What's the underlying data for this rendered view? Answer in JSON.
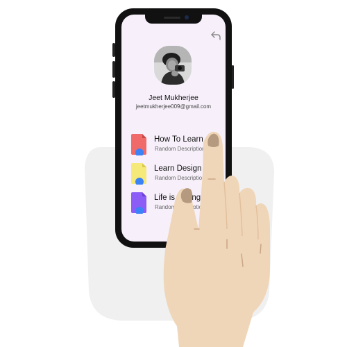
{
  "profile": {
    "name": "Jeet Mukherjee",
    "email": "jeetmukherjee009@gmail.com"
  },
  "items": [
    {
      "title": "How To Learn",
      "description": "Random Description",
      "icon": "document-icon",
      "color": "#f06a6a"
    },
    {
      "title": "Learn Design",
      "description": "Random Description",
      "icon": "document-icon",
      "color": "#f5e97a"
    },
    {
      "title": "Life is Strange",
      "description": "Random Description",
      "icon": "document-icon",
      "color": "#8b5cf6"
    }
  ],
  "icons": {
    "back": "back-arrow-icon",
    "avatar": "profile-photo"
  },
  "colors": {
    "screen_bg": "#f7f0fb",
    "phone_frame": "#111111",
    "skin": "#f0d6b8",
    "skin_shadow": "#e2c09c",
    "nail": "#b59a80",
    "backdrop": "#f0f0f0",
    "accent_blue": "#3b82f6"
  }
}
